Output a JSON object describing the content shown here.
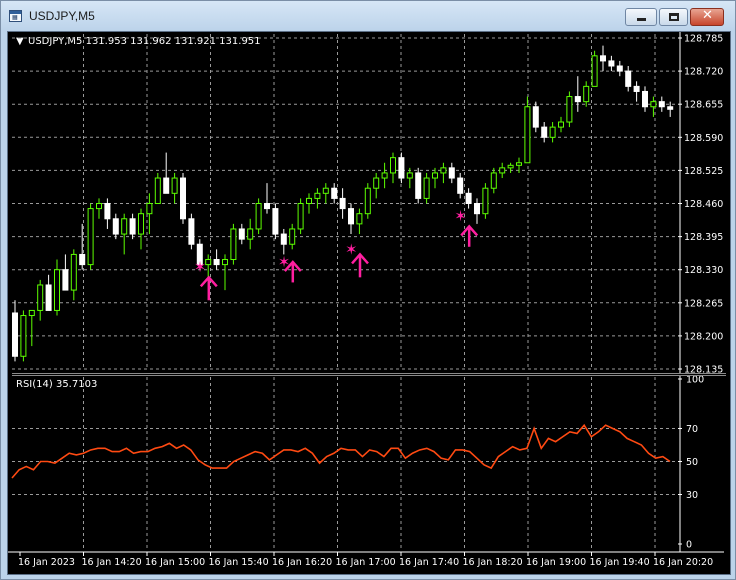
{
  "window": {
    "title": "USDJPY,M5"
  },
  "chart_data": {
    "type": "candlestick",
    "symbol_header": {
      "arrow": "▼",
      "text": "USDJPY,M5  131.953 131.962 131.921 131.951"
    },
    "price_axis": {
      "ticks": [
        "128.785",
        "128.720",
        "128.655",
        "128.590",
        "128.525",
        "128.460",
        "128.395",
        "128.330",
        "128.265",
        "128.200",
        "128.135"
      ],
      "range": [
        128.135,
        128.785
      ]
    },
    "time_axis": {
      "ticks": [
        "16 Jan 2023",
        "16 Jan 14:20",
        "16 Jan 15:00",
        "16 Jan 15:40",
        "16 Jan 16:20",
        "16 Jan 17:00",
        "16 Jan 17:40",
        "16 Jan 18:20",
        "16 Jan 19:00",
        "16 Jan 19:40",
        "16 Jan 20:20"
      ]
    },
    "grid": true,
    "up_color": "#5dff00",
    "down_color": "#ffffff",
    "candles": [
      [
        128.245,
        128.27,
        128.15,
        128.16
      ],
      [
        128.16,
        128.25,
        128.15,
        128.24
      ],
      [
        128.24,
        128.25,
        128.18,
        128.25
      ],
      [
        128.25,
        128.31,
        128.23,
        128.3
      ],
      [
        128.3,
        128.32,
        128.25,
        128.25
      ],
      [
        128.25,
        128.35,
        128.24,
        128.33
      ],
      [
        128.33,
        128.36,
        128.29,
        128.29
      ],
      [
        128.29,
        128.37,
        128.27,
        128.36
      ],
      [
        128.36,
        128.42,
        128.33,
        128.34
      ],
      [
        128.34,
        128.46,
        128.33,
        128.45
      ],
      [
        128.45,
        128.47,
        128.43,
        128.46
      ],
      [
        128.46,
        128.47,
        128.41,
        128.43
      ],
      [
        128.43,
        128.44,
        128.39,
        128.4
      ],
      [
        128.4,
        128.44,
        128.36,
        128.43
      ],
      [
        128.43,
        128.44,
        128.39,
        128.4
      ],
      [
        128.4,
        128.45,
        128.37,
        128.44
      ],
      [
        128.44,
        128.48,
        128.4,
        128.46
      ],
      [
        128.46,
        128.52,
        128.46,
        128.51
      ],
      [
        128.51,
        128.56,
        128.48,
        128.48
      ],
      [
        128.48,
        128.52,
        128.46,
        128.51
      ],
      [
        128.51,
        128.52,
        128.42,
        128.43
      ],
      [
        128.43,
        128.44,
        128.37,
        128.38
      ],
      [
        128.38,
        128.39,
        128.33,
        128.34
      ],
      [
        128.34,
        128.36,
        128.31,
        128.35
      ],
      [
        128.35,
        128.37,
        128.33,
        128.34
      ],
      [
        128.34,
        128.36,
        128.29,
        128.35
      ],
      [
        128.35,
        128.42,
        128.34,
        128.41
      ],
      [
        128.41,
        128.42,
        128.38,
        128.39
      ],
      [
        128.39,
        128.43,
        128.37,
        128.41
      ],
      [
        128.41,
        128.47,
        128.4,
        128.46
      ],
      [
        128.46,
        128.5,
        128.44,
        128.45
      ],
      [
        128.45,
        128.46,
        128.39,
        128.4
      ],
      [
        128.4,
        128.41,
        128.36,
        128.38
      ],
      [
        128.38,
        128.42,
        128.37,
        128.41
      ],
      [
        128.41,
        128.47,
        128.4,
        128.46
      ],
      [
        128.46,
        128.48,
        128.44,
        128.47
      ],
      [
        128.47,
        128.49,
        128.45,
        128.48
      ],
      [
        128.48,
        128.5,
        128.46,
        128.49
      ],
      [
        128.49,
        128.5,
        128.46,
        128.47
      ],
      [
        128.47,
        128.49,
        128.43,
        128.45
      ],
      [
        128.45,
        128.46,
        128.4,
        128.42
      ],
      [
        128.42,
        128.45,
        128.4,
        128.44
      ],
      [
        128.44,
        128.5,
        128.43,
        128.49
      ],
      [
        128.49,
        128.52,
        128.47,
        128.51
      ],
      [
        128.51,
        128.54,
        128.49,
        128.52
      ],
      [
        128.52,
        128.56,
        128.5,
        128.55
      ],
      [
        128.55,
        128.56,
        128.5,
        128.51
      ],
      [
        128.51,
        128.53,
        128.49,
        128.52
      ],
      [
        128.52,
        128.53,
        128.46,
        128.47
      ],
      [
        128.47,
        128.52,
        128.46,
        128.51
      ],
      [
        128.51,
        128.53,
        128.49,
        128.52
      ],
      [
        128.52,
        128.54,
        128.5,
        128.53
      ],
      [
        128.53,
        128.54,
        128.5,
        128.51
      ],
      [
        128.51,
        128.52,
        128.47,
        128.48
      ],
      [
        128.48,
        128.49,
        128.45,
        128.46
      ],
      [
        128.46,
        128.47,
        128.42,
        128.44
      ],
      [
        128.44,
        128.5,
        128.43,
        128.49
      ],
      [
        128.49,
        128.53,
        128.48,
        128.52
      ],
      [
        128.52,
        128.54,
        128.51,
        128.53
      ],
      [
        128.53,
        128.54,
        128.52,
        128.535
      ],
      [
        128.535,
        128.55,
        128.52,
        128.54
      ],
      [
        128.54,
        128.67,
        128.54,
        128.65
      ],
      [
        128.65,
        128.66,
        128.6,
        128.61
      ],
      [
        128.61,
        128.62,
        128.58,
        128.59
      ],
      [
        128.59,
        128.62,
        128.58,
        128.61
      ],
      [
        128.61,
        128.63,
        128.6,
        128.62
      ],
      [
        128.62,
        128.68,
        128.61,
        128.67
      ],
      [
        128.67,
        128.71,
        128.64,
        128.66
      ],
      [
        128.66,
        128.7,
        128.65,
        128.69
      ],
      [
        128.69,
        128.76,
        128.69,
        128.75
      ],
      [
        128.75,
        128.77,
        128.72,
        128.74
      ],
      [
        128.74,
        128.75,
        128.72,
        128.73
      ],
      [
        128.73,
        128.74,
        128.71,
        128.72
      ],
      [
        128.72,
        128.73,
        128.68,
        128.69
      ],
      [
        128.69,
        128.7,
        128.66,
        128.68
      ],
      [
        128.68,
        128.69,
        128.64,
        128.65
      ],
      [
        128.65,
        128.67,
        128.63,
        128.66
      ],
      [
        128.66,
        128.67,
        128.64,
        128.65
      ],
      [
        128.65,
        128.66,
        128.63,
        128.645
      ]
    ],
    "signals": [
      {
        "candle": 22,
        "star_price": 128.335,
        "arrow_top": 128.315,
        "arrow_bottom": 128.27
      },
      {
        "candle": 32,
        "star_price": 128.345,
        "arrow_top": 128.345,
        "arrow_bottom": 128.305
      },
      {
        "candle": 40,
        "star_price": 128.37,
        "arrow_top": 128.36,
        "arrow_bottom": 128.315
      },
      {
        "candle": 53,
        "star_price": 128.435,
        "arrow_top": 128.415,
        "arrow_bottom": 128.375
      }
    ],
    "signal_color": "#ff1fa0",
    "rsi": {
      "label": "RSI(14) 35.7103",
      "ticks": [
        "100",
        "70",
        "50",
        "30",
        "0"
      ],
      "levels": [
        70,
        50,
        30
      ],
      "range": [
        0,
        100
      ],
      "line_color": "#ff4a12",
      "values": [
        40,
        45,
        47,
        45,
        50,
        50,
        49,
        52,
        55,
        54,
        55,
        57,
        58,
        58,
        56,
        56,
        58,
        55,
        56,
        56,
        58,
        59,
        61,
        58,
        60,
        57,
        51,
        48,
        46,
        46,
        46,
        50,
        52,
        54,
        56,
        55,
        51,
        54,
        57,
        57,
        56,
        58,
        55,
        49,
        53,
        55,
        58,
        57,
        57,
        53,
        57,
        56,
        53,
        58,
        58,
        52,
        55,
        57,
        58,
        56,
        52,
        51,
        57,
        57,
        56,
        52,
        48,
        46,
        53,
        56,
        59,
        57,
        58,
        70,
        58,
        64,
        62,
        65,
        68,
        67,
        72,
        65,
        68,
        72,
        70,
        68,
        64,
        62,
        60,
        55,
        52,
        53,
        50
      ]
    }
  }
}
